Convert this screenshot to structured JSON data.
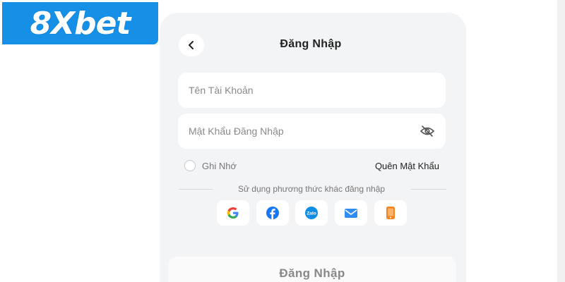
{
  "brand": {
    "logo_text": "8Xbet",
    "color": "#1590e6"
  },
  "header": {
    "title": "Đăng Nhập",
    "back_icon": "chevron-left-icon"
  },
  "form": {
    "username_placeholder": "Tên Tài Khoản",
    "password_placeholder": "Mật Khẩu Đăng Nhập",
    "password_toggle_icon": "eye-off-icon",
    "remember_label": "Ghi Nhớ",
    "remember_checked": false,
    "forgot_label": "Quên Mật Khẩu"
  },
  "alt_login": {
    "label": "Sử dụng phương thức khác đăng nhập",
    "methods": [
      {
        "name": "google",
        "icon": "google-icon",
        "color": "#4285f4"
      },
      {
        "name": "facebook",
        "icon": "facebook-icon",
        "color": "#1877f2"
      },
      {
        "name": "zalo",
        "icon": "zalo-icon",
        "text": "Zalo",
        "color": "#0e8ee6"
      },
      {
        "name": "email",
        "icon": "mail-icon",
        "color": "#2f8cf0"
      },
      {
        "name": "phone",
        "icon": "phone-icon",
        "color": "#f5841f"
      }
    ]
  },
  "submit": {
    "label": "Đăng Nhập"
  }
}
